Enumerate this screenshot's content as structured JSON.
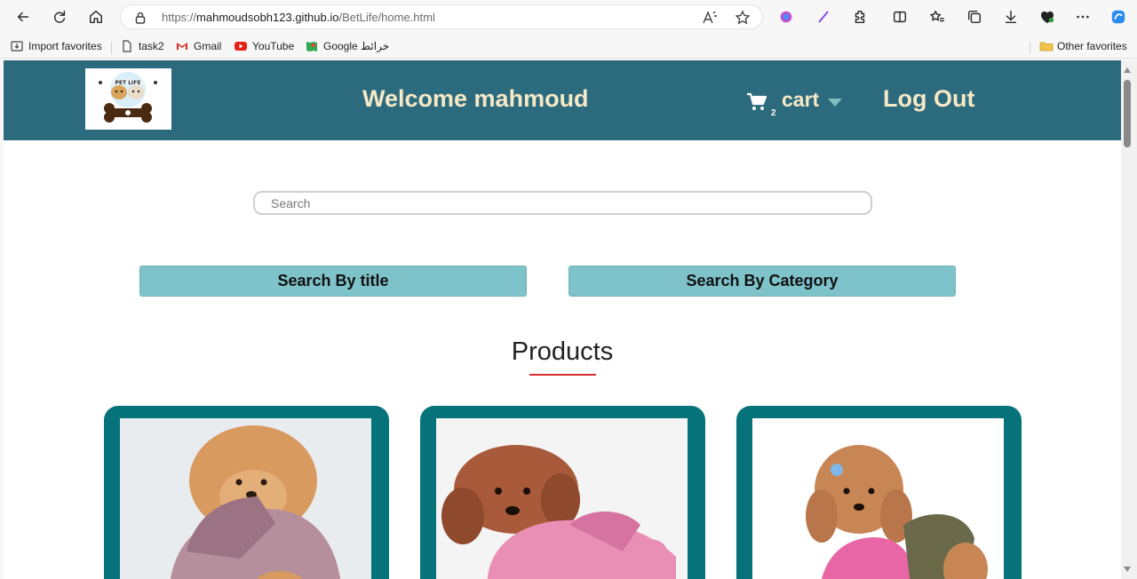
{
  "browser": {
    "url_prefix": "https://",
    "url_host": "mahmoudsobh123.github.io",
    "url_path": "/BetLife/home.html"
  },
  "bookmarks": {
    "items": [
      {
        "label": "Import favorites",
        "icon": "import-icon"
      },
      {
        "label": "task2",
        "icon": "page-icon"
      },
      {
        "label": "Gmail",
        "icon": "gmail-icon"
      },
      {
        "label": "YouTube",
        "icon": "youtube-icon"
      },
      {
        "label": "Google خرائط",
        "icon": "google-maps-icon"
      }
    ],
    "other_favorites": "Other favorites"
  },
  "header": {
    "logo_text": "PET LIFE",
    "welcome": "Welcome mahmoud",
    "cart_label": "cart",
    "cart_count": "2",
    "logout": "Log Out",
    "background": "#2c6a7e",
    "text_color": "#f6e9c5"
  },
  "search": {
    "placeholder": "Search",
    "value": ""
  },
  "filters": {
    "by_title": "Search By title",
    "by_category": "Search By Category",
    "color": "#7ec3c9"
  },
  "products": {
    "heading": "Products",
    "accent": "#d62d2d",
    "card_color": "#06737a",
    "items": [
      {
        "image": "apricot-poodle-in-mauve-coat"
      },
      {
        "image": "brown-poodle-in-pink-costume"
      },
      {
        "image": "apricot-poodle-in-pink-and-olive-vest"
      }
    ]
  }
}
